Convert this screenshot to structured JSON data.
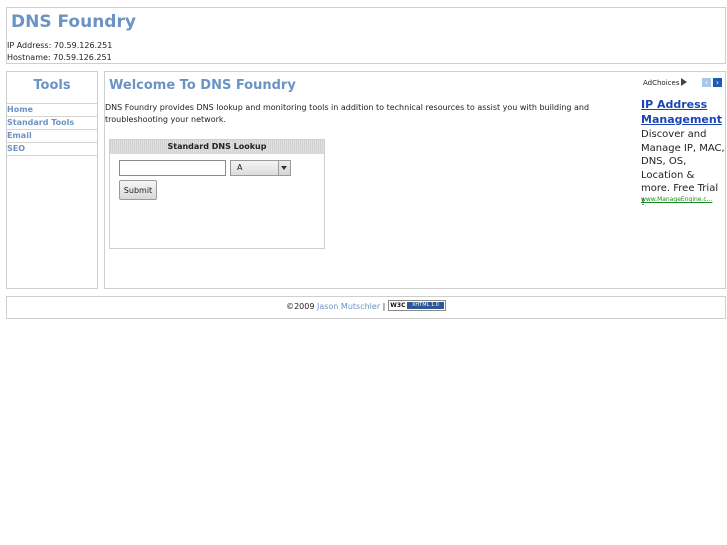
{
  "header": {
    "title": "DNS Foundry",
    "ip_line": "IP Address: 70.59.126.251",
    "host_line": "Hostname: 70.59.126.251"
  },
  "sidebar": {
    "title": "Tools",
    "items": [
      {
        "label": "Home"
      },
      {
        "label": "Standard Tools"
      },
      {
        "label": "Email"
      },
      {
        "label": "SEO"
      }
    ]
  },
  "main": {
    "title": "Welcome To DNS Foundry",
    "intro": "DNS Foundry provides DNS lookup and monitoring tools in addition to technical resources to assist you with building and troubleshooting your network.",
    "lookup": {
      "header": "Standard DNS Lookup",
      "input_value": "",
      "record_type": "A",
      "submit_label": "Submit"
    }
  },
  "ad": {
    "choices_label": "AdChoices",
    "prev_glyph": "‹",
    "next_glyph": "›",
    "title": "IP Address Management",
    "description": "Discover and Manage IP, MAC, DNS, OS, Location & more. Free Trial !",
    "url": "www.ManageEngine.c..."
  },
  "footer": {
    "copyright": "©2009",
    "author": "Jason Mutschler",
    "separator": "|",
    "badge_left": "W3C",
    "badge_right": "XHTML 1.0"
  },
  "colors": {
    "accent": "#6b93c3",
    "ad_link": "#1a44b8",
    "ad_url": "#1c8a1c",
    "border": "#cfcfcf"
  }
}
